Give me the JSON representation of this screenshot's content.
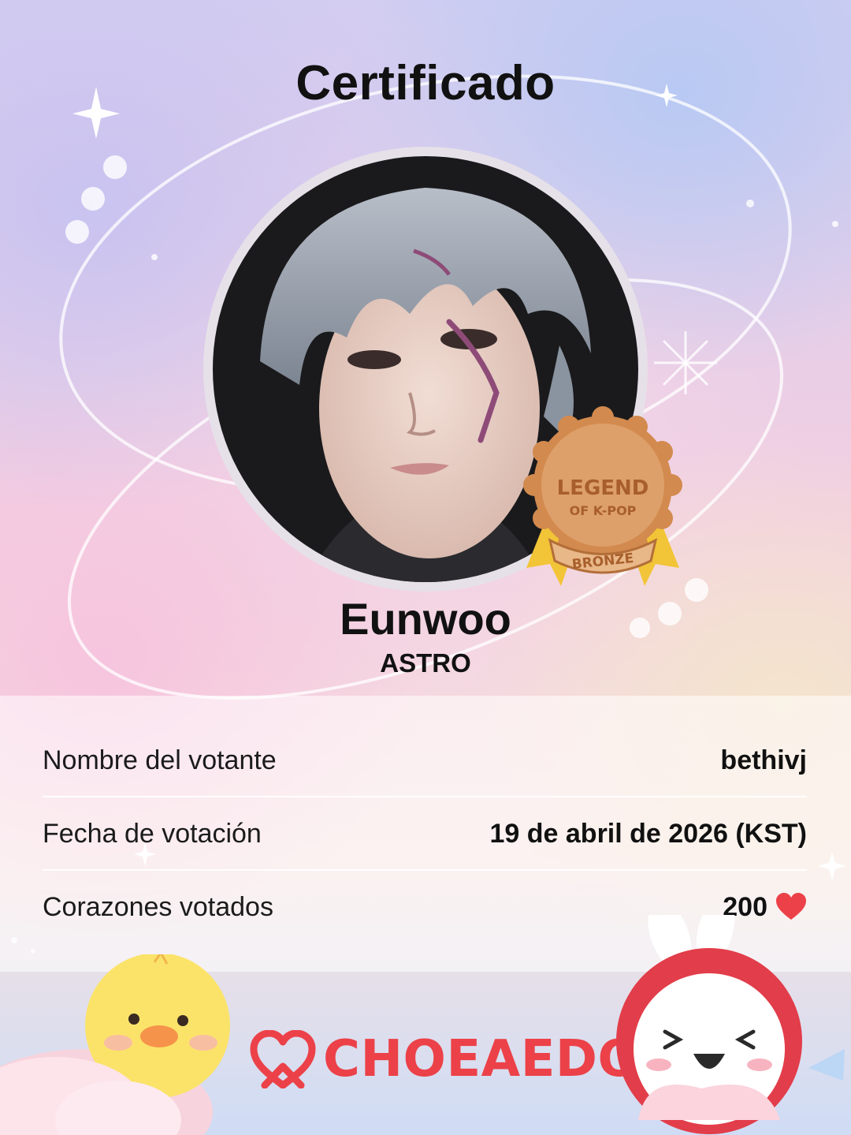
{
  "certificate": {
    "title": "Certificado",
    "idol_name": "Eunwoo",
    "group": "ASTRO"
  },
  "badge": {
    "line1": "LEGEND",
    "line2": "OF K-POP",
    "tier": "BRONZE",
    "color": "#d28a4e"
  },
  "details": [
    {
      "label": "Nombre del votante",
      "value": "bethivj"
    },
    {
      "label": "Fecha de votación",
      "value": "19 de abril de 2026 (KST)"
    },
    {
      "label": "Corazones votados",
      "value": "200",
      "icon": "heart-icon"
    }
  ],
  "brand": {
    "name": "CHOEAEDOL",
    "color": "#ec4148"
  }
}
